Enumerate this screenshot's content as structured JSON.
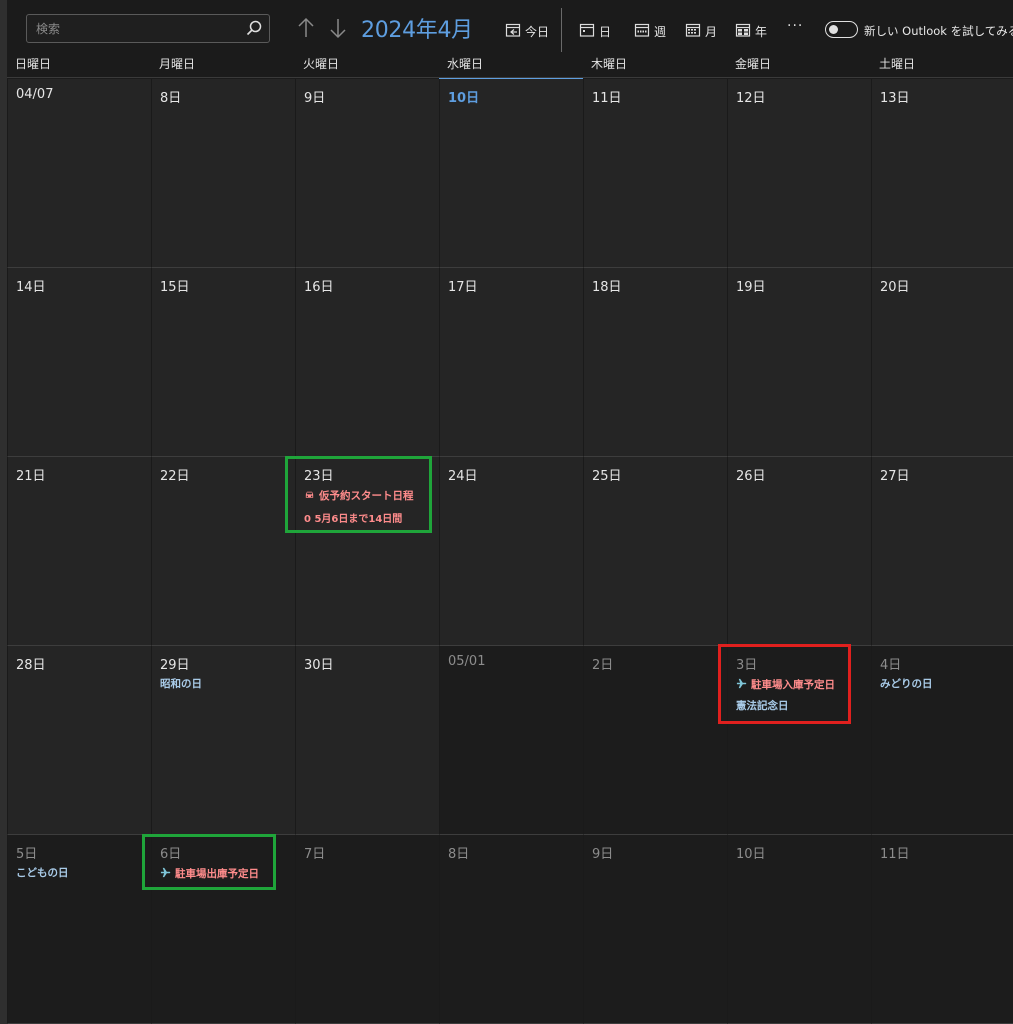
{
  "search": {
    "placeholder": "検索"
  },
  "header": {
    "month_title": "2024年4月",
    "today_label": "今日",
    "day_label": "日",
    "week_label": "週",
    "month_label": "月",
    "year_label": "年",
    "more_label": "···",
    "toggle_label": "新しい Outlook を試してみる"
  },
  "weekdays": [
    "日曜日",
    "月曜日",
    "火曜日",
    "水曜日",
    "木曜日",
    "金曜日",
    "土曜日"
  ],
  "weeks": [
    [
      "04/07",
      "8日",
      "9日",
      "10日",
      "11日",
      "12日",
      "13日"
    ],
    [
      "14日",
      "15日",
      "16日",
      "17日",
      "18日",
      "19日",
      "20日"
    ],
    [
      "21日",
      "22日",
      "23日",
      "24日",
      "25日",
      "26日",
      "27日"
    ],
    [
      "28日",
      "29日",
      "30日",
      "05/01",
      "2日",
      "3日",
      "4日"
    ],
    [
      "5日",
      "6日",
      "7日",
      "8日",
      "9日",
      "10日",
      "11日"
    ]
  ],
  "events": {
    "reservation_title": "仮予約スタート日程",
    "reservation_sub": "0 5月6日まで14日間",
    "parking_in": "駐車場入庫予定日",
    "parking_out": "駐車場出庫予定日"
  },
  "holidays": {
    "showa": "昭和の日",
    "kenpo": "憲法記念日",
    "midori": "みどりの日",
    "kodomo": "こどもの日"
  },
  "colors": {
    "accent": "#5e9ee0",
    "event_text": "#ff8c8c",
    "holiday_text": "#a9cbe8",
    "highlight_green": "#1fa53a",
    "highlight_red": "#e0201e"
  }
}
